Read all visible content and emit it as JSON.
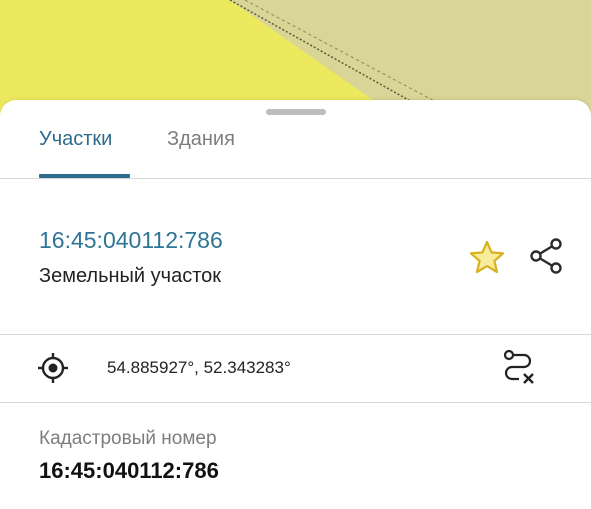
{
  "tabs": [
    {
      "label": "Участки",
      "active": true
    },
    {
      "label": "Здания",
      "active": false
    }
  ],
  "parcel": {
    "cadastral_number": "16:45:040112:786",
    "type": "Земельный участок"
  },
  "location": {
    "coordinates": "54.885927°, 52.343283°"
  },
  "details": {
    "cadastral_label": "Кадастровый номер",
    "cadastral_value": "16:45:040112:786"
  },
  "icons": {
    "favorite": "star-icon",
    "share": "share-icon",
    "locate": "crosshair-icon",
    "route": "route-clear-icon"
  },
  "colors": {
    "accent": "#2e6b8c",
    "link": "#2f7596",
    "map_yellow": "#ece95f",
    "map_khaki": "#d9d596",
    "star": "#e3c53c"
  }
}
